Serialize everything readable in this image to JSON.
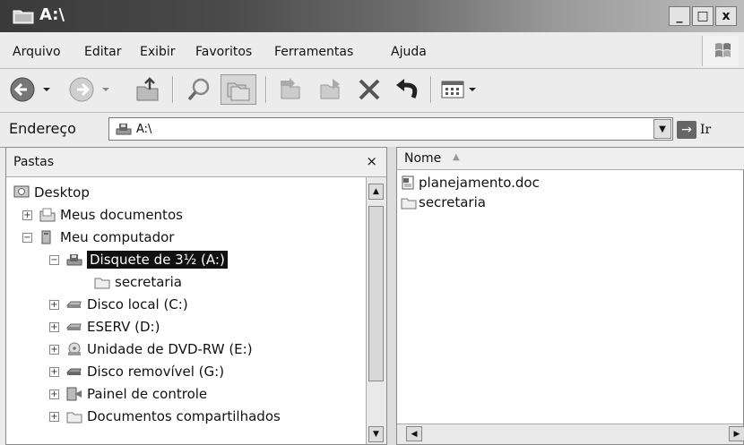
{
  "window": {
    "title": "A:\\"
  },
  "titlebar_buttons": [
    "_",
    "□",
    "x"
  ],
  "menu": [
    "Arquivo",
    "Editar",
    "Exibir",
    "Favoritos",
    "Ferramentas",
    "Ajuda"
  ],
  "address": {
    "label": "Endereço",
    "value": "A:\\",
    "go_label": "Ir"
  },
  "folders_pane": {
    "title": "Pastas",
    "close": "×",
    "tree": [
      {
        "label": "Desktop",
        "expander": "",
        "icon": "desktop-icon"
      },
      {
        "label": "Meus documentos",
        "expander": "+",
        "icon": "documents-folder-icon"
      },
      {
        "label": "Meu computador",
        "expander": "−",
        "icon": "computer-icon"
      },
      {
        "label": "Disquete de 3½ (A:)",
        "expander": "−",
        "icon": "floppy-drive-icon",
        "selected": true
      },
      {
        "label": "secretaria",
        "expander": "",
        "icon": "folder-icon"
      },
      {
        "label": "Disco local (C:)",
        "expander": "+",
        "icon": "hard-drive-icon"
      },
      {
        "label": "ESERV (D:)",
        "expander": "+",
        "icon": "hard-drive-icon"
      },
      {
        "label": "Unidade de DVD-RW (E:)",
        "expander": "+",
        "icon": "dvd-drive-icon"
      },
      {
        "label": "Disco removível (G:)",
        "expander": "+",
        "icon": "removable-drive-icon"
      },
      {
        "label": "Painel de controle",
        "expander": "+",
        "icon": "control-panel-icon"
      },
      {
        "label": "Documentos compartilhados",
        "expander": "+",
        "icon": "shared-folder-icon"
      }
    ]
  },
  "files_pane": {
    "column_name": "Nome",
    "items": [
      {
        "label": "planejamento.doc",
        "icon": "document-icon"
      },
      {
        "label": "secretaria",
        "icon": "folder-icon"
      }
    ]
  }
}
